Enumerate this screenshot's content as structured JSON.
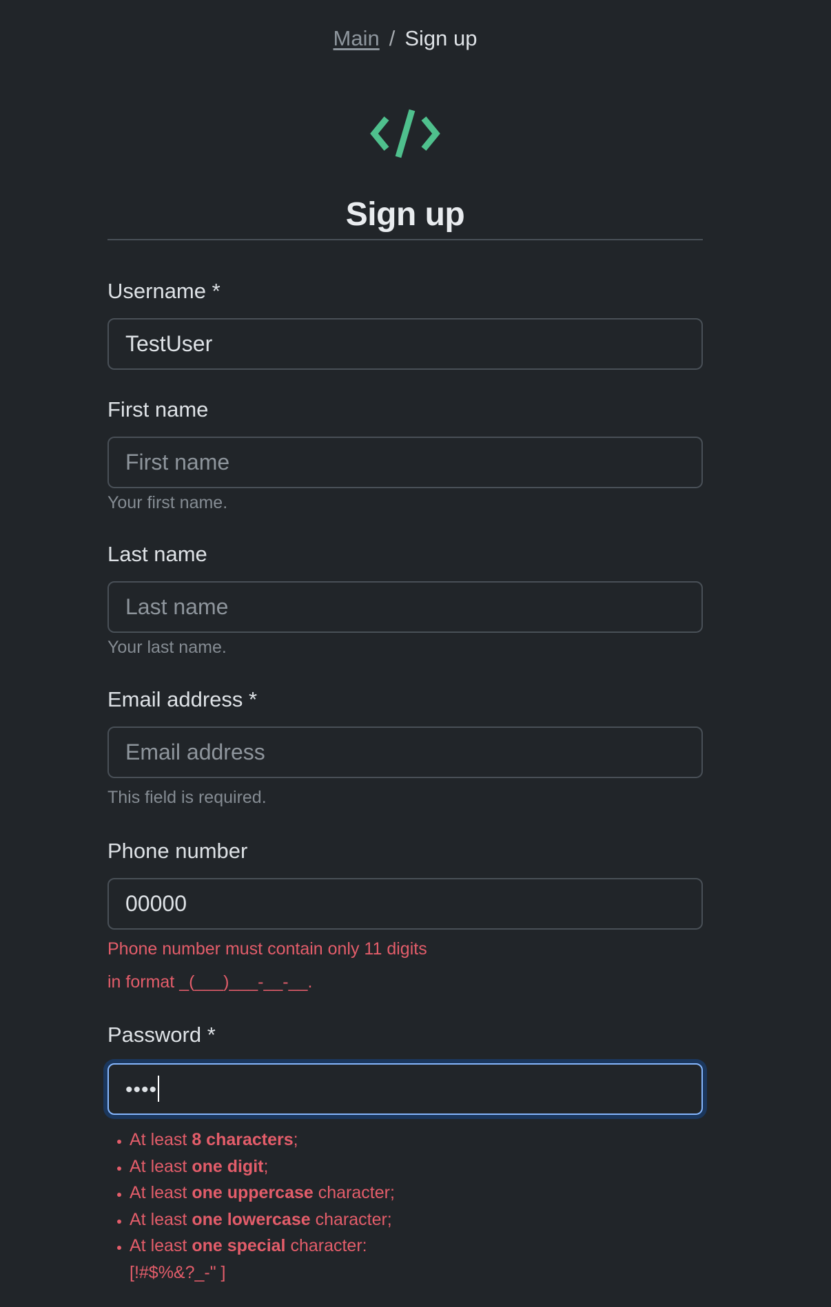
{
  "breadcrumb": {
    "home_label": "Main",
    "separator": "/",
    "current_label": "Sign up"
  },
  "logo": {
    "icon": "code-icon",
    "color": "#4fc08d"
  },
  "page_title": "Sign up",
  "form": {
    "username": {
      "label": "Username *",
      "value": "TestUser"
    },
    "first_name": {
      "label": "First name",
      "placeholder": "First name",
      "value": "",
      "help": "Your first name."
    },
    "last_name": {
      "label": "Last name",
      "placeholder": "Last name",
      "value": "",
      "help": "Your last name."
    },
    "email": {
      "label": "Email address *",
      "placeholder": "Email address",
      "value": "",
      "help": "This field is required."
    },
    "phone": {
      "label": "Phone number",
      "value": "00000",
      "error_line1": "Phone number must contain only 11 digits",
      "error_line2": "in format _(___)___-__-__."
    },
    "password": {
      "label": "Password *",
      "masked_value": "••••",
      "rules": [
        {
          "prefix": "At least ",
          "bold": "8 characters",
          "suffix": ";"
        },
        {
          "prefix": "At least ",
          "bold": "one digit",
          "suffix": ";"
        },
        {
          "prefix": "At least ",
          "bold": "one uppercase",
          "suffix": " character;"
        },
        {
          "prefix": "At least ",
          "bold": "one lowercase",
          "suffix": " character;"
        },
        {
          "prefix": "At least ",
          "bold": "one special",
          "suffix": " character: [!#$%&?_-\" ]"
        }
      ]
    }
  },
  "colors": {
    "background": "#212529",
    "error": "#e35d6a",
    "focus_border": "#86b7fe",
    "accent": "#4fc08d"
  }
}
